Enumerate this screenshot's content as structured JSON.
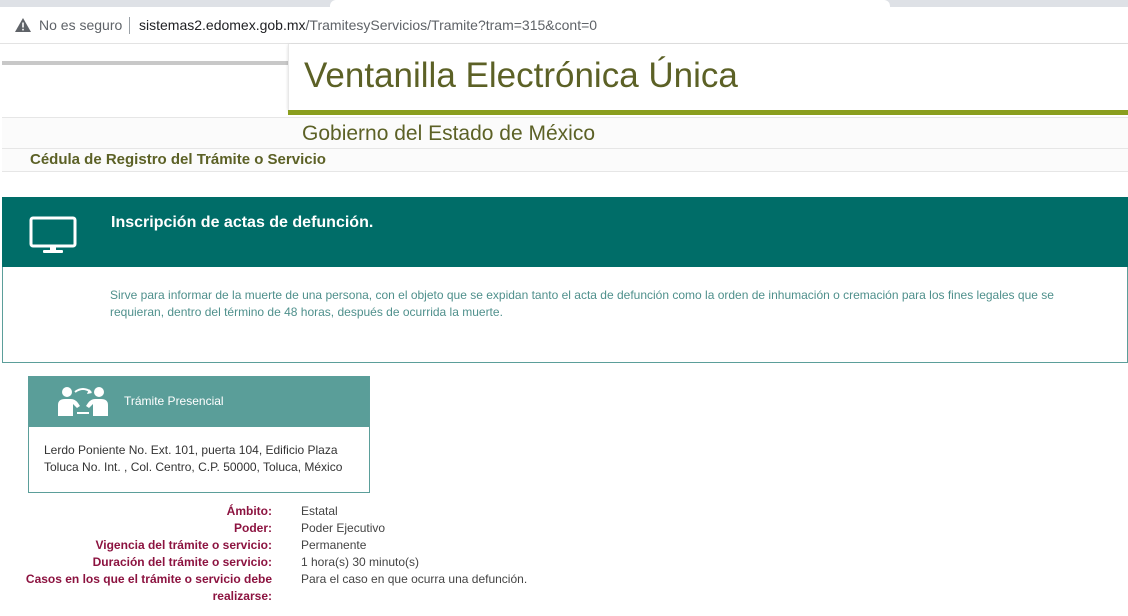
{
  "browser": {
    "security_label": "No es seguro",
    "url_host": "sistemas2.edomex.gob.mx",
    "url_path": "/TramitesyServicios/Tramite?tram=315&cont=0",
    "warning_icon": "warning-triangle-icon"
  },
  "header": {
    "title": "Ventanilla Electrónica Única",
    "subtitle": "Gobierno del Estado de México",
    "section": "Cédula de Registro del Trámite o Servicio"
  },
  "service": {
    "icon": "monitor-icon",
    "title": "Inscripción de actas de defunción.",
    "description": "Sirve para informar de la muerte de una persona, con el objeto que se expidan tanto el acta de defunción como la orden de inhumación o cremación para los fines legales que se requieran, dentro del término de 48 horas, después de ocurrida la muerte."
  },
  "presencial": {
    "icon": "people-exchange-icon",
    "title": "Trámite Presencial",
    "address": "Lerdo Poniente No. Ext. 101, puerta 104, Edificio Plaza Toluca No. Int. , Col. Centro, C.P. 50000, Toluca, México"
  },
  "details": [
    {
      "label": "Ámbito:",
      "value": "Estatal"
    },
    {
      "label": "Poder:",
      "value": "Poder Ejecutivo"
    },
    {
      "label": "Vigencia del trámite o servicio:",
      "value": "Permanente"
    },
    {
      "label": "Duración del trámite o servicio:",
      "value": "1 hora(s) 30 minuto(s)"
    },
    {
      "label": "Casos en los que el trámite o servicio debe realizarse:",
      "value": "Para el caso en que ocurra una defunción."
    }
  ],
  "colors": {
    "title_olive": "#5c6126",
    "underline_green": "#8a9e1e",
    "teal_dark": "#006d68",
    "teal_light": "#5a9e99",
    "label_maroon": "#8c1340"
  }
}
